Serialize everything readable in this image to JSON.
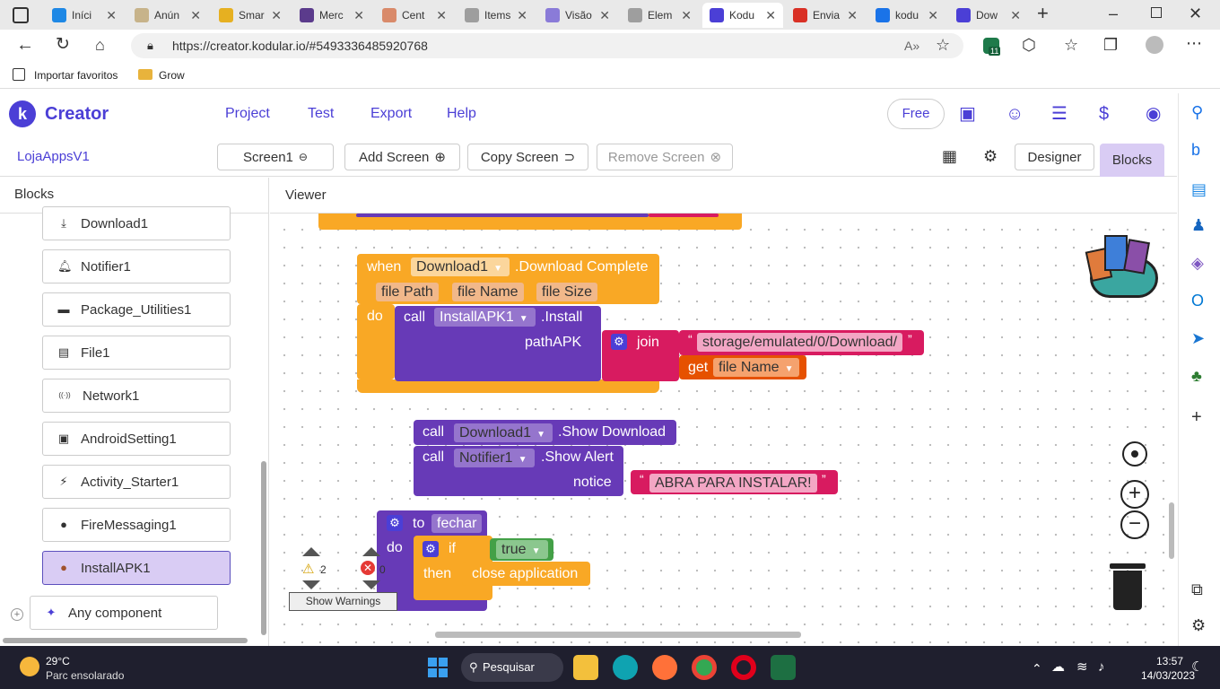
{
  "browser": {
    "tabs": [
      {
        "title": "Iníci",
        "color": "#1e88e5"
      },
      {
        "title": "Anún",
        "color": "#c7b38a"
      },
      {
        "title": "Smar",
        "color": "#e6b021"
      },
      {
        "title": "Merc",
        "color": "#5b3b8c"
      },
      {
        "title": "Cent",
        "color": "#d98a6a"
      },
      {
        "title": "Items",
        "color": "#9e9e9e"
      },
      {
        "title": "Visão",
        "color": "#8a7bd8"
      },
      {
        "title": "Elem",
        "color": "#9e9e9e"
      },
      {
        "title": "Kodu",
        "color": "#4b3fd6"
      },
      {
        "title": "Envia",
        "color": "#d93025"
      },
      {
        "title": "kodu",
        "color": "#1a73e8"
      },
      {
        "title": "Dow",
        "color": "#4b3fd6"
      }
    ],
    "url": "https://creator.kodular.io/#5493336485920768",
    "extension_badge": "11",
    "favorites": [
      "Importar favoritos",
      "Grow"
    ]
  },
  "app": {
    "brand": "Creator",
    "menu": [
      "Project",
      "Test",
      "Export",
      "Help"
    ],
    "plan_button": "Free",
    "project_name": "LojaAppsV1",
    "screen_select": "Screen1",
    "add_screen": "Add Screen",
    "copy_screen": "Copy Screen",
    "remove_screen": "Remove Screen",
    "designer_tab": "Designer",
    "blocks_tab": "Blocks",
    "accent": "#5b4fbd"
  },
  "blocks_panel": {
    "title": "Blocks",
    "components": [
      {
        "label": "Download1",
        "icon": "download-icon"
      },
      {
        "label": "Notifier1",
        "icon": "bell-icon"
      },
      {
        "label": "Package_Utilities1",
        "icon": "package-icon"
      },
      {
        "label": "File1",
        "icon": "file-icon"
      },
      {
        "label": "Network1",
        "icon": "network-icon"
      },
      {
        "label": "AndroidSetting1",
        "icon": "android-setting-icon"
      },
      {
        "label": "Activity_Starter1",
        "icon": "activity-icon"
      },
      {
        "label": "FireMessaging1",
        "icon": "firebase-icon"
      },
      {
        "label": "InstallAPK1",
        "icon": "install-apk-icon"
      }
    ],
    "any_component": "Any component"
  },
  "viewer": {
    "title": "Viewer",
    "event_block": {
      "when": "when",
      "component": "Download1",
      "event": ".Download Complete",
      "params": [
        "file Path",
        "file Name",
        "file Size"
      ],
      "do": "do",
      "call": "call",
      "call_component": "InstallAPK1",
      "call_method": ".Install",
      "arg_name": "pathAPK",
      "join": "join",
      "string_value": "storage/emulated/0/Download/",
      "get": "get",
      "get_var": "file Name"
    },
    "call_show_download": {
      "call": "call",
      "component": "Download1",
      "method": ".Show Download"
    },
    "call_show_alert": {
      "call": "call",
      "component": "Notifier1",
      "method": ".Show Alert",
      "arg_name": "notice",
      "string_value": "ABRA PARA INSTALAR!"
    },
    "proc_block": {
      "to": "to",
      "name": "fechar",
      "do": "do",
      "if": "if",
      "bool": "true",
      "then": "then",
      "action": "close application"
    },
    "warnings_count": "2",
    "errors_count": "0",
    "show_warnings": "Show Warnings"
  },
  "taskbar": {
    "weather_temp": "29°C",
    "weather_desc": "Parc ensolarado",
    "search": "Pesquisar",
    "time": "13:57",
    "date": "14/03/2023"
  }
}
